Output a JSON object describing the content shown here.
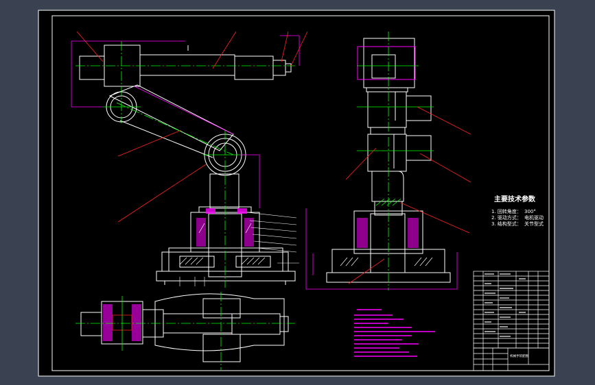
{
  "colors": {
    "background": "#000000",
    "frame": "#ffffff",
    "part": "#ffffff",
    "centerline": "#00ff00",
    "leader": "#ff2020",
    "dimension": "#ff00ff",
    "hatch_fill": "#ff00ff",
    "note_text": "#ff00ff",
    "title_text": "#ffffff",
    "outer_bg": "#3a4150"
  },
  "tech_params": {
    "title": "主要技术参数",
    "items": [
      {
        "label": "1. 回转角度：",
        "value": "300°"
      },
      {
        "label": "2. 驱动方式：",
        "value": "电机驱动"
      },
      {
        "label": "3. 结构型式：",
        "value": "关节型式"
      }
    ]
  },
  "title_block": {
    "drawing_name": "机械手装配图"
  }
}
